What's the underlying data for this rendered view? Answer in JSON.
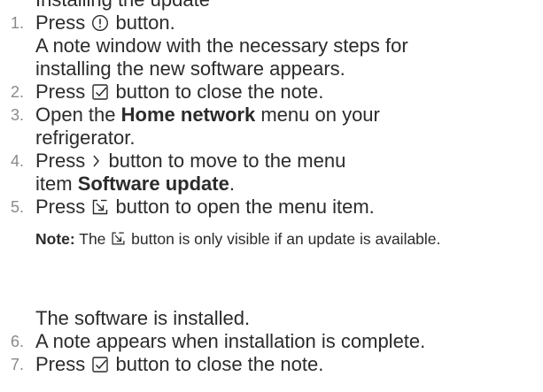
{
  "cutoff_text": "Installing the update",
  "steps": [
    {
      "number": "1.",
      "pre": "Press ",
      "icon": "info-circle-icon",
      "post": " button."
    },
    {
      "number": "2.",
      "pre": "Press ",
      "icon": "checkbox-check-icon",
      "post": " button to close the note."
    },
    {
      "number": "3.",
      "pre": "Open the ",
      "bold": "Home network",
      "post": " menu on your"
    },
    {
      "number": "4.",
      "pre": "Press ",
      "icon": "chevron-right-icon",
      "post": " button to move to the menu"
    },
    {
      "number": "5.",
      "pre": "Press ",
      "icon": "download-box-icon",
      "post": " button to open the menu item."
    },
    {
      "number": "6.",
      "text": "A note appears when installation is complete."
    },
    {
      "number": "7.",
      "pre": "Press ",
      "icon": "checkbox-check-icon",
      "post": " button to close the note."
    }
  ],
  "step1_sub": [
    "A note window with the necessary steps for",
    "installing the new software appears."
  ],
  "step3_sub": "refrigerator.",
  "step4_sub": {
    "pre": "item ",
    "bold": "Software update",
    "post": "."
  },
  "note": {
    "label": "Note:",
    "pre": " The ",
    "icon": "download-box-icon",
    "post": " button is only visible if an update is available."
  },
  "result_text": "The software is installed."
}
